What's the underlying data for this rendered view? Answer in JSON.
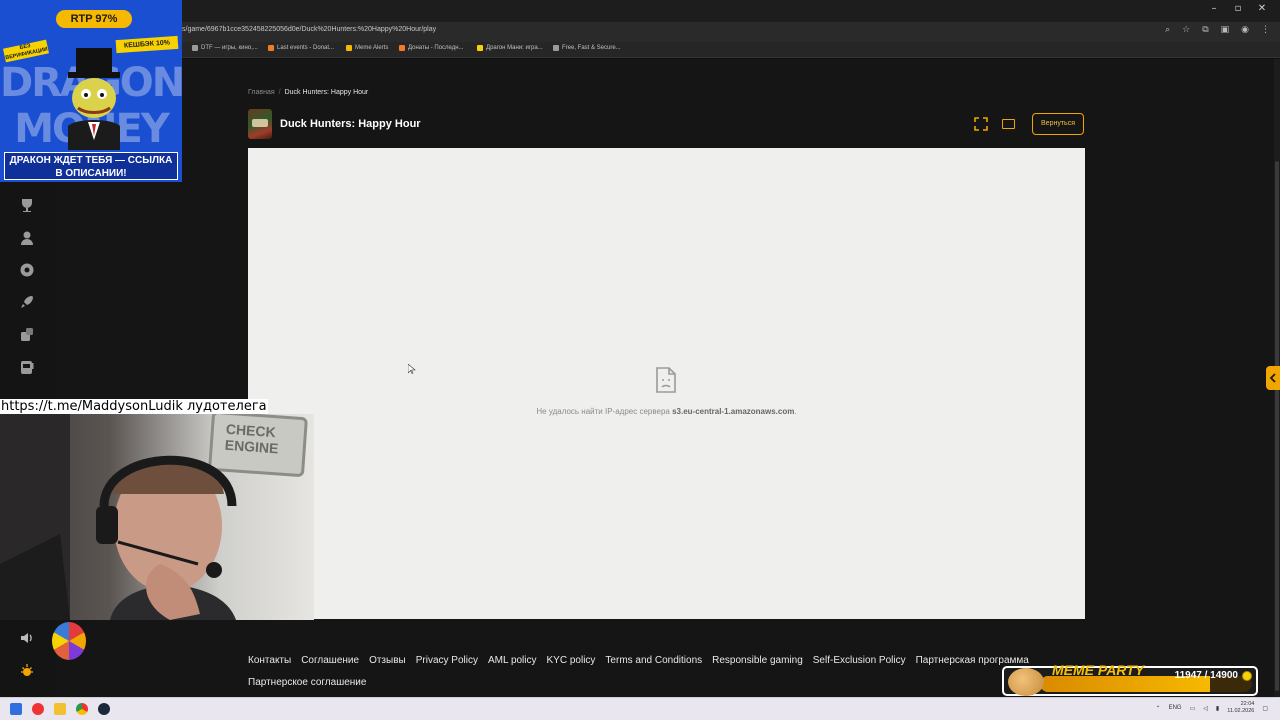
{
  "browser": {
    "url": "s/game/6967b1cce352458225056d0e/Duck%20Hunters:%20Happy%20Hour/play",
    "window_controls": [
      "–",
      "▫",
      "✕"
    ],
    "bookmarks": [
      {
        "label": "DTF — игры, кино,...",
        "color": "#9a9a9a"
      },
      {
        "label": "Last events - Donat...",
        "color": "#f07a2a"
      },
      {
        "label": "Meme Alerts",
        "color": "#f6b900"
      },
      {
        "label": "Донаты - Последн...",
        "color": "#f07a2a"
      },
      {
        "label": "Драгон Мани: игра...",
        "color": "#f6d200"
      },
      {
        "label": "Free, Fast & Secure...",
        "color": "#9a9a9a"
      }
    ]
  },
  "page": {
    "breadcrumb": {
      "home": "Главная",
      "separator": "/",
      "current": "Duck Hunters: Happy Hour"
    },
    "game_title": "Duck Hunters: Happy Hour",
    "back_button": "Вернуться",
    "accent_color": "#f0a500",
    "error": {
      "prefix": "Не удалось найти IP-адрес сервера ",
      "host": "s3.eu-central-1.amazonaws.com",
      "suffix": "."
    }
  },
  "sidebar": {
    "icons": [
      "trophy-icon",
      "user-icon",
      "casino-chip-icon",
      "rocket-icon",
      "dice-icon",
      "slot-machine-icon",
      "volume-icon",
      "sun-icon"
    ]
  },
  "footer": {
    "links": [
      "Контакты",
      "Соглашение",
      "Отзывы",
      "Privacy Policy",
      "AML policy",
      "KYC policy",
      "Terms and Conditions",
      "Responsible gaming",
      "Self-Exclusion Policy",
      "Партнерская программа"
    ],
    "second_row": "Партнерское соглашение"
  },
  "overlays": {
    "promo": {
      "rtp": "RTP 97%",
      "no_verification": "БЕЗ ВЕРИФИКАЦИИ",
      "cashback": "КЕШБЭК 10%",
      "brand": "DRAGON MONEY",
      "cta": "ДРАКОН ЖДЕТ ТЕБЯ — ССЫЛКА В ОПИСАНИИ!"
    },
    "telegram_link": "https://t.me/MaddysonLudik лудотелега",
    "webcam_sign": "CHECK ENGINE",
    "meme_party": {
      "title": "MEME PARTY",
      "current": 11947,
      "goal": 14900,
      "progress": 0.8018,
      "text": "11947 / 14900"
    }
  },
  "taskbar": {
    "lang": "ENG",
    "time": "22:04",
    "date": "11.02.2026"
  }
}
